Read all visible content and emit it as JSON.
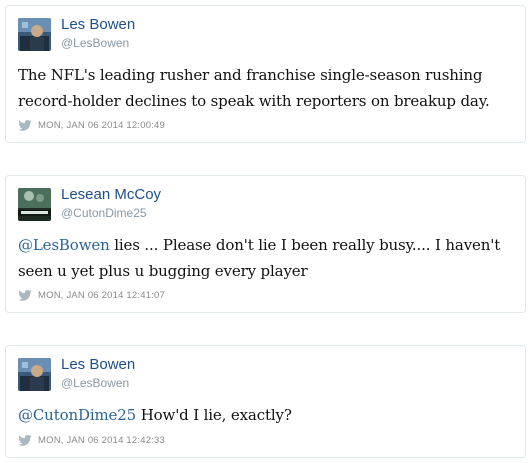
{
  "tweets": [
    {
      "name": "Les Bowen",
      "handle": "@LesBowen",
      "text_parts": {
        "mention": "",
        "body": "The NFL's leading rusher and franchise single-season rushing record-holder declines to speak with reporters on breakup day."
      },
      "timestamp": "MON, JAN 06 2014 12:00:49"
    },
    {
      "name": "Lesean McCoy",
      "handle": "@CutonDime25",
      "text_parts": {
        "mention": "@LesBowen",
        "body": " lies ... Please don't lie I been really busy.... I haven't seen u yet plus u bugging every player"
      },
      "timestamp": "MON, JAN 06 2014 12:41:07"
    },
    {
      "name": "Les Bowen",
      "handle": "@LesBowen",
      "text_parts": {
        "mention": "@CutonDime25",
        "body": " How'd I lie, exactly?"
      },
      "timestamp": "MON, JAN 06 2014 12:42:33"
    }
  ],
  "colors": {
    "name": "#1e4f8a",
    "mention": "#2a6496",
    "meta": "#8a8a8a",
    "border": "#e1e8ed",
    "bird_icon": "#aab8c2"
  },
  "icons": {
    "timestamp_icon": "twitter-bird-icon"
  }
}
